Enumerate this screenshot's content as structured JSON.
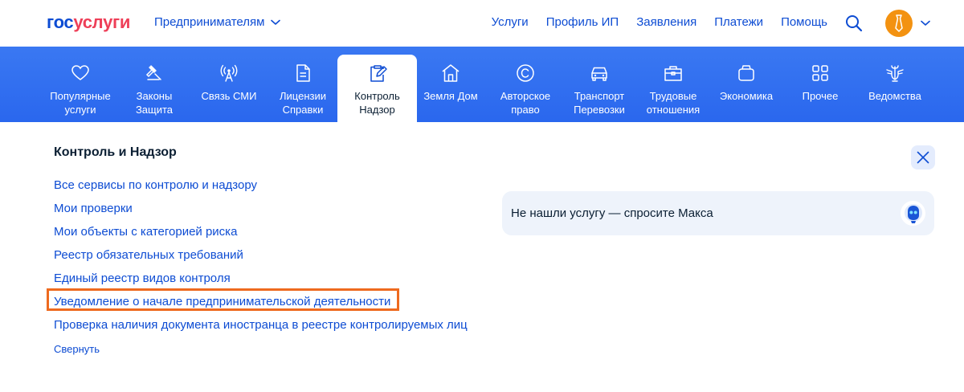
{
  "header": {
    "logo_part1": "гос",
    "logo_part2": "услуги",
    "segment_label": "Предпринимателям",
    "nav": [
      "Услуги",
      "Профиль ИП",
      "Заявления",
      "Платежи",
      "Помощь"
    ]
  },
  "categories": [
    {
      "label_line1": "Популярные",
      "label_line2": "услуги",
      "icon": "heart-icon"
    },
    {
      "label_line1": "Законы",
      "label_line2": "Защита",
      "icon": "gavel-icon"
    },
    {
      "label_line1": "Связь СМИ",
      "label_line2": "",
      "icon": "antenna-icon"
    },
    {
      "label_line1": "Лицензии",
      "label_line2": "Справки",
      "icon": "document-icon"
    },
    {
      "label_line1": "Контроль",
      "label_line2": "Надзор",
      "icon": "clipboard-edit-icon",
      "active": true
    },
    {
      "label_line1": "Земля Дом",
      "label_line2": "",
      "icon": "house-icon"
    },
    {
      "label_line1": "Авторское",
      "label_line2": "право",
      "icon": "copyright-icon"
    },
    {
      "label_line1": "Транспорт",
      "label_line2": "Перевозки",
      "icon": "car-icon"
    },
    {
      "label_line1": "Трудовые",
      "label_line2": "отношения",
      "icon": "briefcase-icon"
    },
    {
      "label_line1": "Экономика",
      "label_line2": "",
      "icon": "wallet-icon"
    },
    {
      "label_line1": "Прочее",
      "label_line2": "",
      "icon": "grid-icon"
    },
    {
      "label_line1": "Ведомства",
      "label_line2": "",
      "icon": "emblem-icon"
    }
  ],
  "section": {
    "title": "Контроль и Надзор",
    "links": [
      "Все сервисы по контролю и надзору",
      "Мои проверки",
      "Мои объекты с категорией риска",
      "Реестр обязательных требований",
      "Единый реестр видов контроля",
      "Уведомление о начале предпринимательской деятельности",
      "Проверка наличия документа иностранца в реестре контролируемых лиц"
    ],
    "highlighted_link_index": 5,
    "collapse_label": "Свернуть"
  },
  "assistant": {
    "text": "Не нашли услугу — спросите Макса"
  },
  "colors": {
    "primary": "#0d4cd3",
    "category_bar": "#2f6ef0",
    "logo_accent": "#ee3f58",
    "highlight_border": "#ee6a1f",
    "avatar": "#f39211"
  }
}
